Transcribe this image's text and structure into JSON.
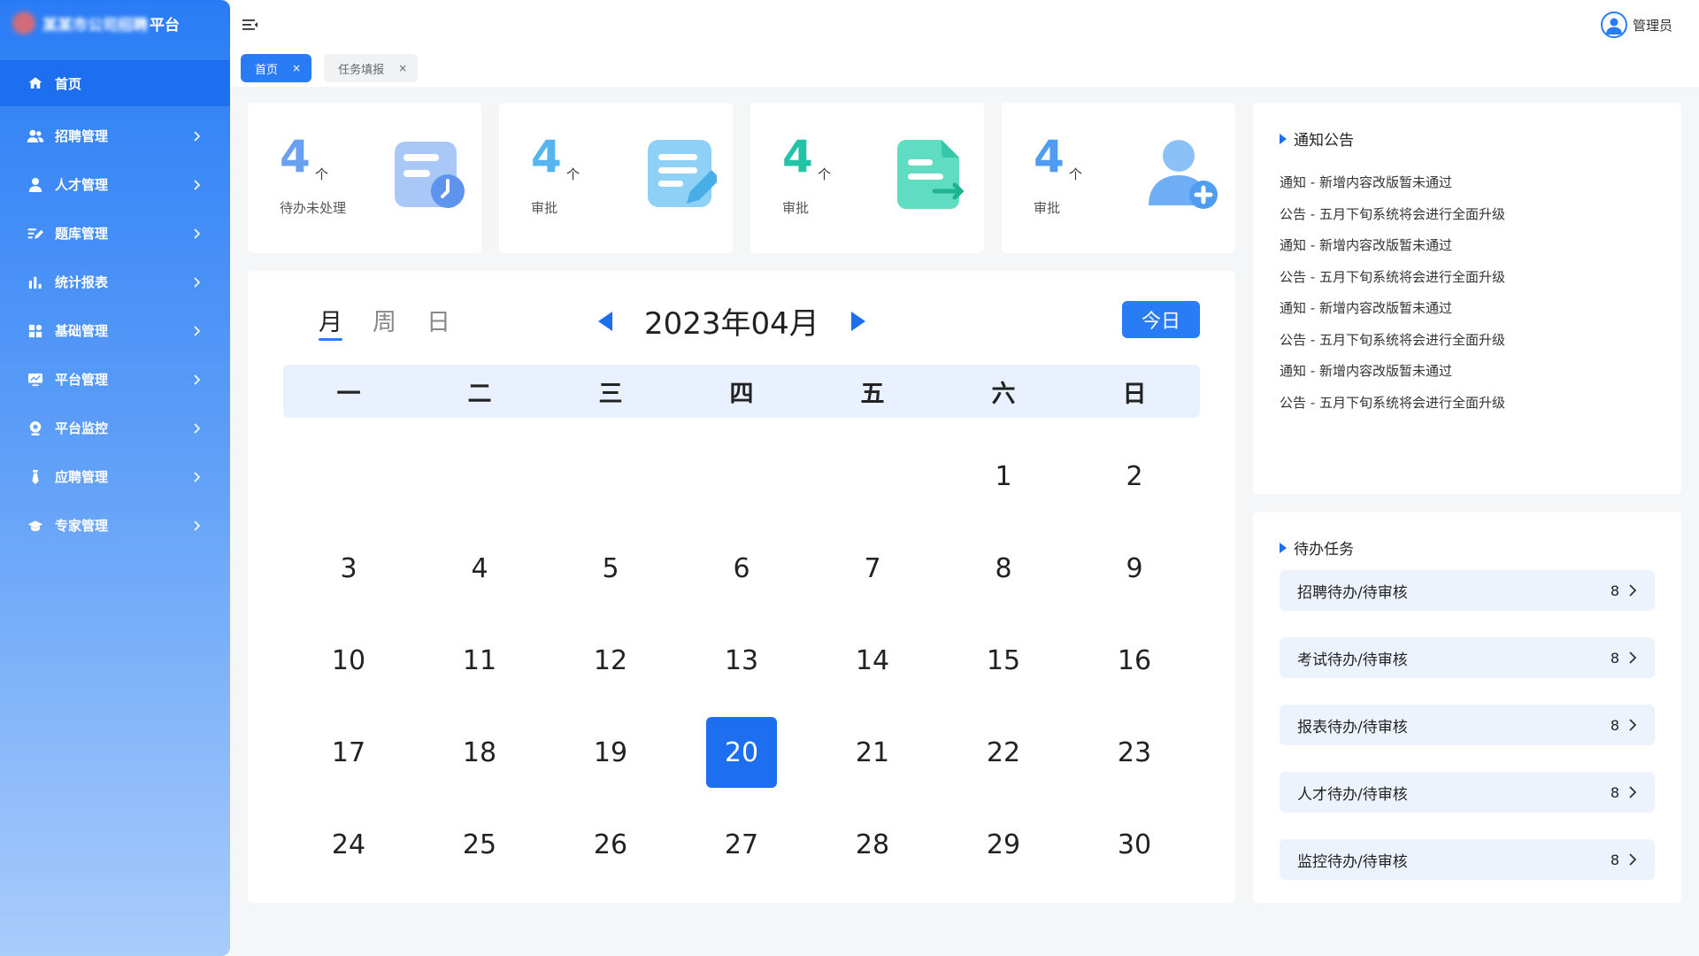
{
  "app": {
    "title_blurred": "某某市公司招聘",
    "title_tail": "平台"
  },
  "sidebar": {
    "items": [
      {
        "label": "首页",
        "icon": "home-icon",
        "active": true
      },
      {
        "label": "招聘管理",
        "icon": "users-icon"
      },
      {
        "label": "人才管理",
        "icon": "person-icon"
      },
      {
        "label": "题库管理",
        "icon": "edit-list-icon"
      },
      {
        "label": "统计报表",
        "icon": "bar-chart-icon"
      },
      {
        "label": "基础管理",
        "icon": "grid-icon"
      },
      {
        "label": "平台管理",
        "icon": "monitor-icon"
      },
      {
        "label": "平台监控",
        "icon": "webcam-icon"
      },
      {
        "label": "应聘管理",
        "icon": "tie-icon"
      },
      {
        "label": "专家管理",
        "icon": "graduation-cap-icon"
      }
    ]
  },
  "topbar": {
    "user": "管理员"
  },
  "tabs": [
    {
      "label": "首页",
      "close": "×",
      "active": true
    },
    {
      "label": "任务填报",
      "close": "×",
      "active": false
    }
  ],
  "stats": [
    {
      "value": "4",
      "unit": "个",
      "label": "待办未处理",
      "color": "#6aa0f0",
      "icon": "clock-document-icon"
    },
    {
      "value": "4",
      "unit": "个",
      "label": "审批",
      "color": "#56b4ee",
      "icon": "notepad-pen-icon"
    },
    {
      "value": "4",
      "unit": "个",
      "label": "审批",
      "color": "#22c3a6",
      "icon": "file-arrow-icon"
    },
    {
      "value": "4",
      "unit": "个",
      "label": "审批",
      "color": "#4f9df2",
      "icon": "user-add-icon"
    }
  ],
  "calendar": {
    "views": [
      "月",
      "周",
      "日"
    ],
    "active_view": "月",
    "title": "2023年04月",
    "today_label": "今日",
    "weekdays": [
      "一",
      "二",
      "三",
      "四",
      "五",
      "六",
      "日"
    ],
    "leading_blanks": 5,
    "days": [
      "1",
      "2",
      "3",
      "4",
      "5",
      "6",
      "7",
      "8",
      "9",
      "10",
      "11",
      "12",
      "13",
      "14",
      "15",
      "16",
      "17",
      "18",
      "19",
      "20",
      "21",
      "22",
      "23",
      "24",
      "25",
      "26",
      "27",
      "28",
      "29",
      "30"
    ],
    "selected": "20"
  },
  "notice": {
    "title": "通知公告",
    "items": [
      "通知 - 新增内容改版暂未通过",
      "公告 - 五月下旬系统将会进行全面升级",
      "通知 - 新增内容改版暂未通过",
      "公告 - 五月下旬系统将会进行全面升级",
      "通知 - 新增内容改版暂未通过",
      "公告 - 五月下旬系统将会进行全面升级",
      "通知 - 新增内容改版暂未通过",
      "公告 - 五月下旬系统将会进行全面升级"
    ]
  },
  "tasks": {
    "title": "待办任务",
    "items": [
      {
        "label": "招聘待办/待审核",
        "count": "8"
      },
      {
        "label": "考试待办/待审核",
        "count": "8"
      },
      {
        "label": "报表待办/待审核",
        "count": "8"
      },
      {
        "label": "人才待办/待审核",
        "count": "8"
      },
      {
        "label": "监控待办/待审核",
        "count": "8"
      }
    ]
  }
}
